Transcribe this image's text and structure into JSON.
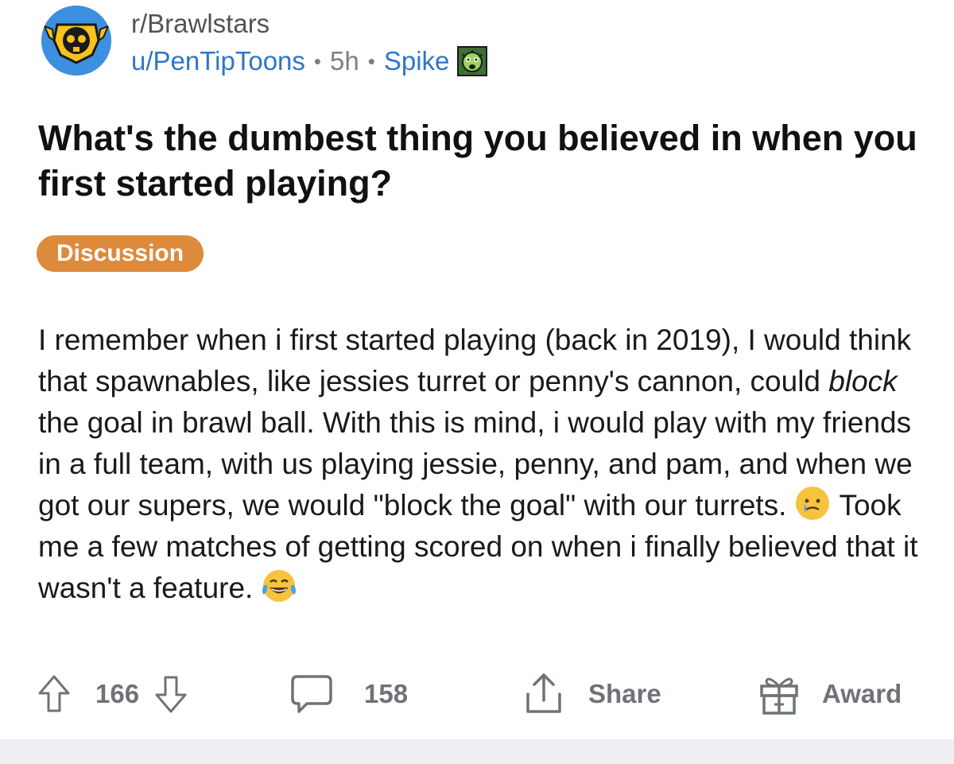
{
  "post": {
    "subreddit": "r/Brawlstars",
    "author": "u/PenTipToons",
    "age": "5h",
    "separator": "•",
    "flair": "Spike",
    "title": "What's the dumbest thing you believed in when you first started playing?",
    "tag": "Discussion",
    "body": {
      "part1": "I remember when i first started playing (back in 2019), I would think that spawnables, like jessies turret or penny's cannon, could ",
      "emphasis": "block",
      "part2": " the goal in brawl ball. With this is mind, i would play with my friends in a full team, with us playing jessie, penny, and pam, and when we got our supers, we would \"block the goal\" with our turrets.",
      "part3": "Took me a few matches of getting scored on when i finally believed that it wasn't a feature."
    },
    "emojis": [
      "sad-smile-emoji",
      "laughing-tears-emoji"
    ]
  },
  "actions": {
    "upvotes": "166",
    "comments": "158",
    "share_label": "Share",
    "award_label": "Award"
  },
  "colors": {
    "link_blue": "#2f75c9",
    "meta_gray": "#7c7f82",
    "tag_orange": "#dd8a3c",
    "avatar_blue": "#3d8fe0",
    "footer_gray": "#efeff3"
  }
}
